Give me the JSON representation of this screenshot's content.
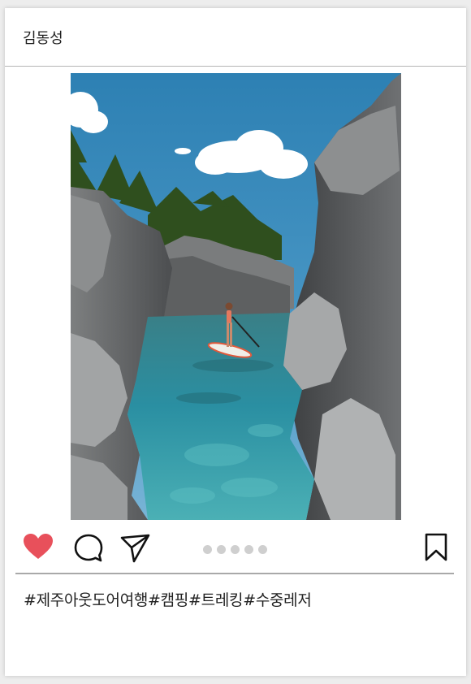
{
  "post": {
    "username": "김동성",
    "caption": "#제주아웃도어여행#캠핑#트레킹#수중레저",
    "image_subject": "paddleboarder in rocky gorge with turquoise water",
    "carousel": {
      "count": 5,
      "active": null
    }
  },
  "actions": {
    "like_icon": "heart-icon",
    "comment_icon": "speech-bubble-icon",
    "share_icon": "paper-plane-icon",
    "save_icon": "bookmark-icon"
  },
  "colors": {
    "heart": "#e8505b",
    "dots": "#cfcfcf",
    "divider": "#a9a9a9"
  }
}
